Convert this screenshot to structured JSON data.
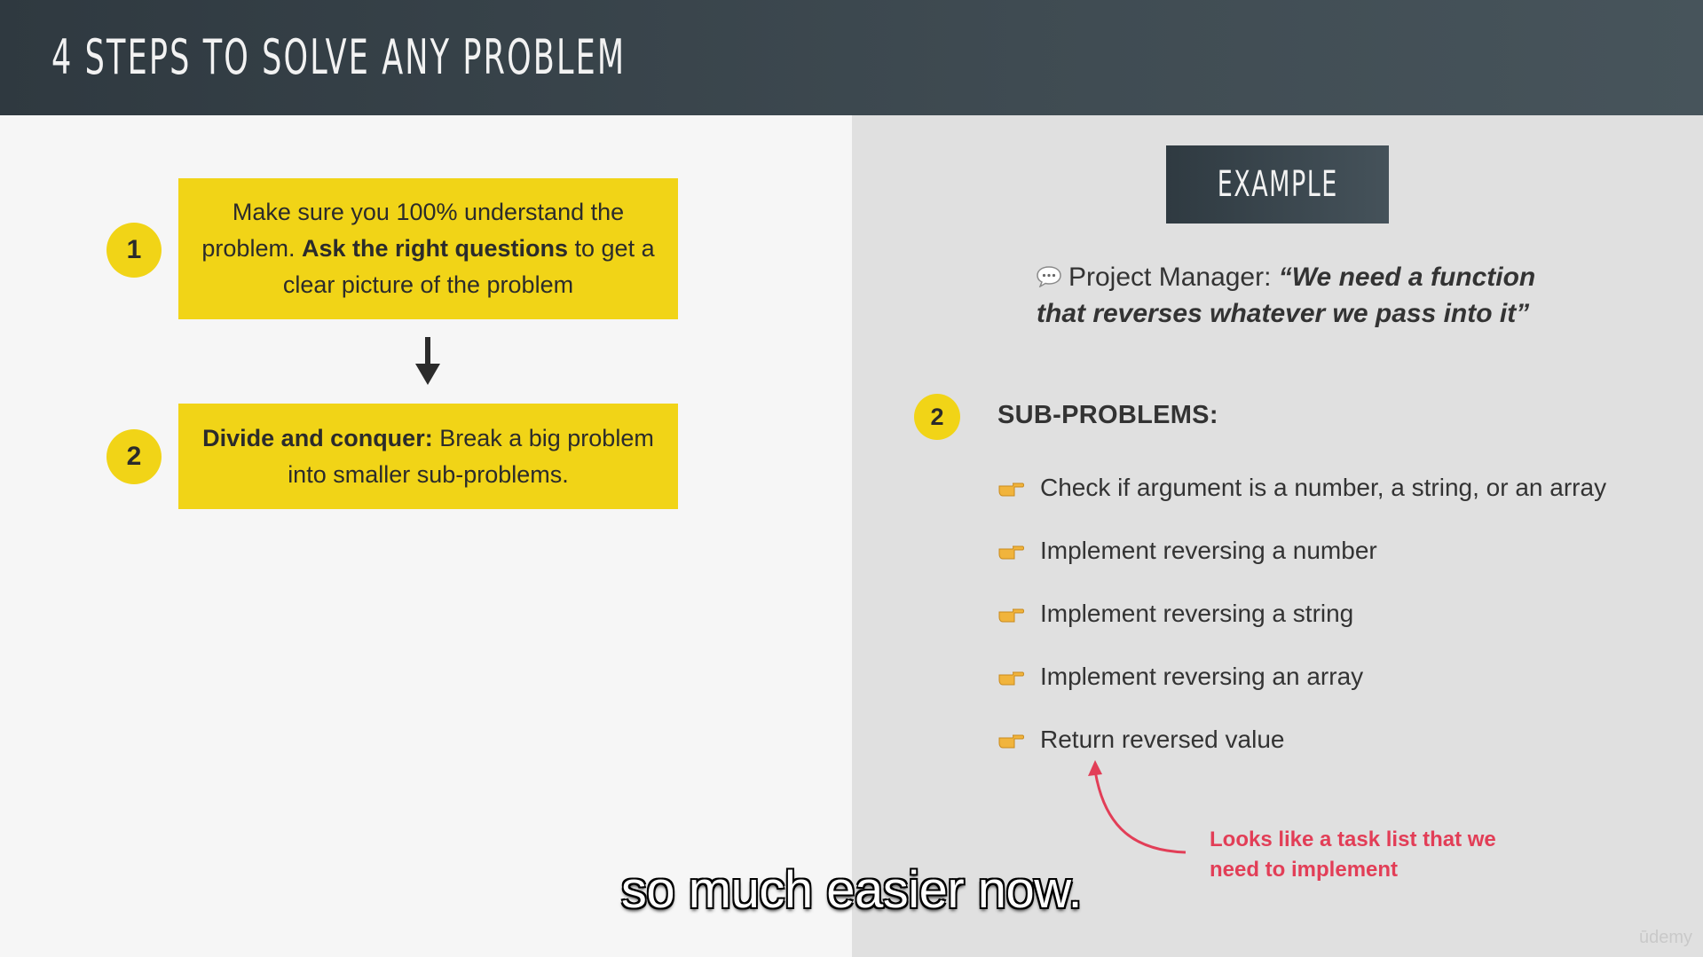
{
  "header": {
    "title": "4 Steps to solve any problem"
  },
  "steps": [
    {
      "number": "1",
      "text_part1": "Make sure you 100% understand the problem. ",
      "text_bold": "Ask the right questions",
      "text_part2": " to get a clear picture of the problem"
    },
    {
      "number": "2",
      "text_bold": "Divide and conquer:",
      "text_part2": " Break a big problem into smaller sub-problems."
    }
  ],
  "example": {
    "badge": "Example",
    "speaker": "Project Manager: ",
    "quote": "“We need a function that reverses whatever we pass into it”",
    "icon": "speech-bubble-icon"
  },
  "subproblems": {
    "number": "2",
    "heading": "SUB-PROBLEMS:",
    "items": [
      "Check if argument is a number, a string, or an array",
      "Implement reversing a number",
      "Implement reversing a string",
      "Implement reversing an array",
      "Return reversed value"
    ],
    "bullet_icon": "pointing-hand-icon"
  },
  "annotation": "Looks like a task list that we need to implement",
  "caption": "so much easier now.",
  "watermark": "ūdemy",
  "colors": {
    "accent_yellow": "#f1d417",
    "annotation_red": "#e23e57",
    "header_dark": "#2f3940"
  }
}
